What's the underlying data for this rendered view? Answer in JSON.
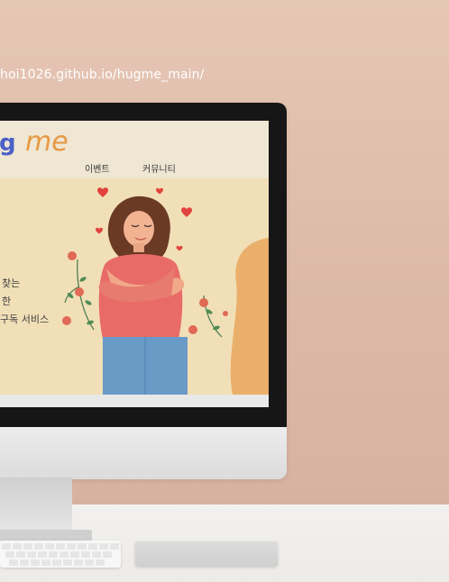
{
  "address": "hoi1026.github.io/hugme_main/",
  "logo": {
    "g": "g",
    "me": "me"
  },
  "nav": {
    "events": "이벤트",
    "community": "커뮤니티"
  },
  "hero": {
    "line1": "찾는",
    "line2": "한",
    "line3": "구독 서비스"
  },
  "colors": {
    "accent_logo_blue": "#4a61c8",
    "accent_logo_orange": "#e79a44",
    "hero_bg": "#f1dfb7",
    "shirt": "#e96b67",
    "jeans": "#6a9ac6"
  }
}
